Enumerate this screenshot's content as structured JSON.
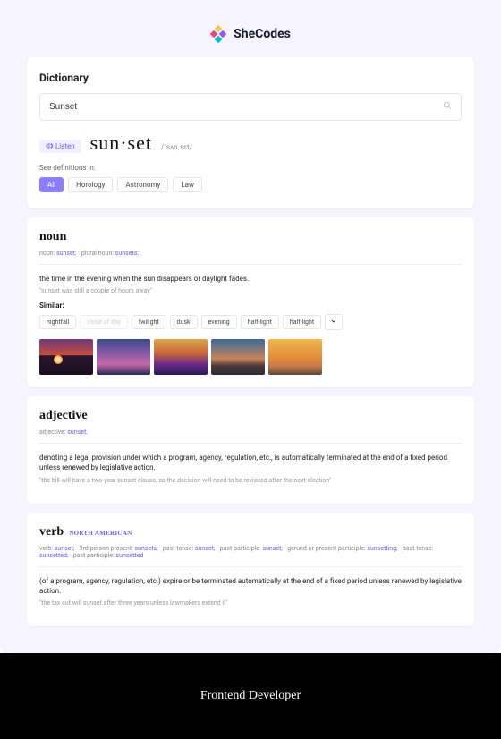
{
  "brand": "SheCodes",
  "page_title": "Dictionary",
  "search": {
    "value": "Sunset"
  },
  "listen_label": "Listen",
  "word": "sun·set",
  "phonetic": "/ˈsʌnˌsɛt/",
  "definitions_in_label": "See definitions in:",
  "categories": [
    "All",
    "Horology",
    "Astronomy",
    "Law"
  ],
  "noun": {
    "heading": "noun",
    "forms_prefix1": "noun: ",
    "forms_w1": "sunset",
    "forms_sep": ";  ·  plural noun: ",
    "forms_w2": "sunsets",
    "forms_suffix": ";",
    "definition": "the time in the evening when the sun disappears or daylight fades.",
    "example": "\"sunset was still a couple of hours away\"",
    "similar_label": "Similar:",
    "similar": [
      "nightfall",
      "close of day",
      "twilight",
      "dusk",
      "evening",
      "half-light",
      "half-light"
    ]
  },
  "adjective": {
    "heading": "adjective",
    "forms_prefix": "adjective: ",
    "forms_w": "sunset",
    "forms_suffix": ";",
    "definition": "denoting a legal provision under which a program, agency, regulation, etc., is automatically terminated at the end of a fixed period unless renewed by legislative action.",
    "example": "\"the bill will have a two-year sunset clause, so the decision will need to be revisited after the next election\""
  },
  "verb": {
    "heading": "verb",
    "region": "NORTH AMERICAN",
    "f1": "verb: ",
    "w1": "sunset",
    "s1": ";  ·  3rd person present: ",
    "w2": "sunsets",
    "s2": ";  ·  past tense: ",
    "w3": "sunset",
    "s3": ";  ·  past participle: ",
    "w4": "sunset",
    "s4": ";  ·  gerund or present participle: ",
    "w5": "sunsetting",
    "s5": ";  ·  past tense: ",
    "w6": "sunsetted",
    "s6": ";  ·  past participle: ",
    "w7": "sunsetted",
    "definition": "(of a program, agency, regulation, etc.) expire or be terminated automatically at the end of a fixed period unless renewed by legislative action.",
    "example": "\"the tax cut will sunset after three years unless lawmakers extend it\""
  },
  "footer": "Frontend Developer"
}
